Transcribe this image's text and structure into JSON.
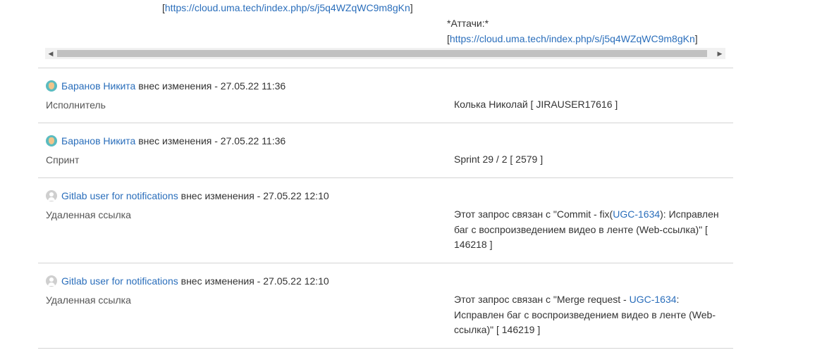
{
  "top": {
    "link_open": "[",
    "link": "https://cloud.uma.tech/index.php/s/j5q4WZqWC9m8gKn",
    "link_close": "]",
    "attach_title": "*Аттачи:*",
    "attach_open": "[",
    "attach_link": "https://cloud.uma.tech/index.php/s/j5q4WZqWC9m8gKn",
    "attach_close": "]"
  },
  "scrollbar": {
    "left_arrow": "◀",
    "right_arrow": "▶"
  },
  "entries": [
    {
      "author": "Баранов Никита",
      "action": "внес изменения - 27.05.22 11:36",
      "field": "Исполнитель",
      "value": "Колька Николай [ JIRAUSER17616 ]"
    },
    {
      "author": "Баранов Никита",
      "action": "внес изменения - 27.05.22 11:36",
      "field": "Спринт",
      "value": "Sprint 29 / 2 [ 2579 ]"
    },
    {
      "author": "Gitlab user for notifications",
      "action": "внес изменения - 27.05.22 12:10",
      "field": "Удаленная ссылка",
      "value_pre": "Этот запрос связан с \"Commit - fix(",
      "value_link": "UGC-1634",
      "value_post": "): Исправлен баг с воспроизведением видео в ленте (Web-ссылка)\" [ 146218 ]"
    },
    {
      "author": "Gitlab user for notifications",
      "action": "внес изменения - 27.05.22 12:10",
      "field": "Удаленная ссылка",
      "value_pre": "Этот запрос связан с \"Merge request - ",
      "value_link": "UGC-1634",
      "value_post": ": Исправлен баг с воспроизведением видео в ленте (Web-ссылка)\" [ 146219 ]"
    }
  ]
}
